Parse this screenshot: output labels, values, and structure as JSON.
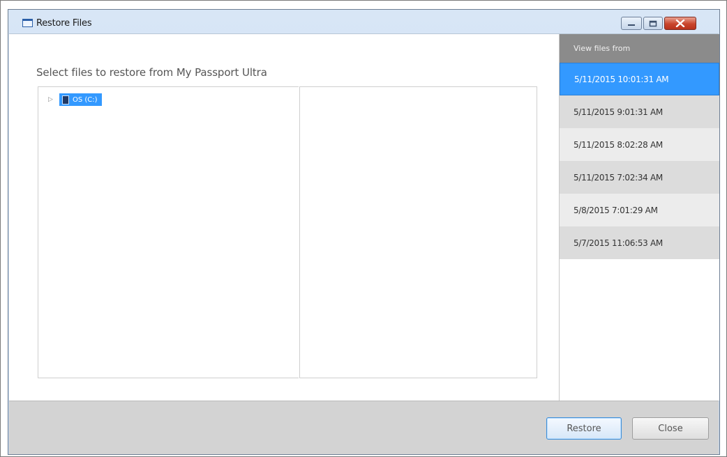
{
  "window": {
    "title": "Restore Files"
  },
  "main": {
    "heading": "Select files to restore from My Passport Ultra",
    "tree": {
      "items": [
        {
          "label": "OS (C:)",
          "selected": true,
          "expander": "▷"
        }
      ]
    }
  },
  "side": {
    "header": "View files from",
    "dates": [
      {
        "label": "5/11/2015 10:01:31 AM",
        "selected": true
      },
      {
        "label": "5/11/2015 9:01:31 AM",
        "selected": false
      },
      {
        "label": "5/11/2015 8:02:28 AM",
        "selected": false
      },
      {
        "label": "5/11/2015 7:02:34 AM",
        "selected": false
      },
      {
        "label": "5/8/2015 7:01:29 AM",
        "selected": false
      },
      {
        "label": "5/7/2015 11:06:53 AM",
        "selected": false
      }
    ]
  },
  "footer": {
    "restore_label": "Restore",
    "close_label": "Close"
  },
  "colors": {
    "selection": "#3399ff",
    "close_button": "#c9452c"
  },
  "icons": {
    "title": "window-icon",
    "drive": "drive-icon",
    "minimize": "minimize-icon",
    "maximize": "maximize-icon",
    "close": "close-icon"
  }
}
